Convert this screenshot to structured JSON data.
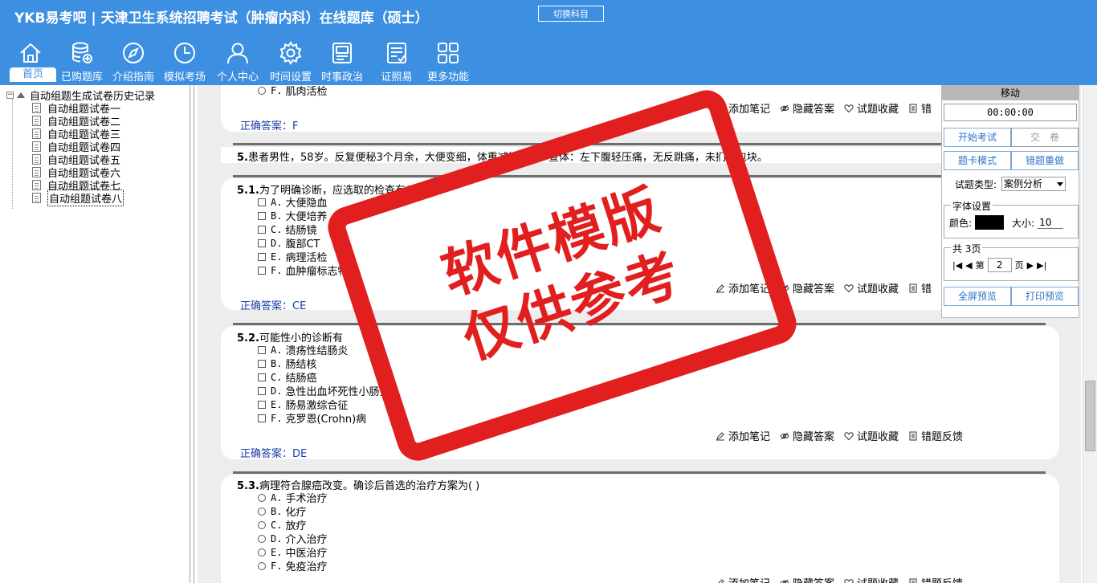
{
  "header": {
    "logo": "YKB易考吧",
    "title": "天津卫生系统招聘考试（肿瘤内科）在线题库（硕士）",
    "switch_subject": "切换科目"
  },
  "nav": [
    {
      "label": "首页",
      "icon": "home-icon"
    },
    {
      "label": "已购题库",
      "icon": "database-icon"
    },
    {
      "label": "介绍指南",
      "icon": "compass-icon"
    },
    {
      "label": "模拟考场",
      "icon": "clock-icon"
    },
    {
      "label": "个人中心",
      "icon": "user-icon"
    },
    {
      "label": "时间设置",
      "icon": "gear-icon"
    },
    {
      "label": "时事政治",
      "icon": "news-icon"
    },
    {
      "label": "证照易",
      "icon": "certificate-icon"
    },
    {
      "label": "更多功能",
      "icon": "grid-icon"
    }
  ],
  "tree": {
    "root": "自动组题生成试卷历史记录",
    "items": [
      "自动组题试卷一",
      "自动组题试卷二",
      "自动组题试卷三",
      "自动组题试卷四",
      "自动组题试卷五",
      "自动组题试卷六",
      "自动组题试卷七",
      "自动组题试卷八"
    ]
  },
  "actions": {
    "note": "添加笔记",
    "hide": "隐藏答案",
    "fav": "试题收藏",
    "feedback": "错题反馈",
    "feedback_short": "错"
  },
  "prev": {
    "last_option_key": "F.",
    "last_option_text": "肌肉活检",
    "answer_label": "正确答案：",
    "answer": "F"
  },
  "case": {
    "num": "5.",
    "text": "患者男性，58岁。反复便秘3个月余，大便变细，体重减轻3kg。查体：左下腹轻压痛，无反跳痛，未扪及包块。"
  },
  "questions": [
    {
      "num": "5.1.",
      "text": "为了明确诊断，应选取的检查有( )",
      "options": [
        {
          "k": "A.",
          "t": "大便隐血"
        },
        {
          "k": "B.",
          "t": "大便培养"
        },
        {
          "k": "C.",
          "t": "结肠镜"
        },
        {
          "k": "D.",
          "t": "腹部CT"
        },
        {
          "k": "E.",
          "t": "病理活检"
        },
        {
          "k": "F.",
          "t": "血肿瘤标志物"
        }
      ],
      "answer_label": "正确答案：",
      "answer": "CE"
    },
    {
      "num": "5.2.",
      "text": "可能性小的诊断有",
      "options": [
        {
          "k": "A.",
          "t": "溃疡性结肠炎"
        },
        {
          "k": "B.",
          "t": "肠结核"
        },
        {
          "k": "C.",
          "t": "结肠癌"
        },
        {
          "k": "D.",
          "t": "急性出血坏死性小肠炎"
        },
        {
          "k": "E.",
          "t": "肠易激综合征"
        },
        {
          "k": "F.",
          "t": "克罗恩(Crohn)病"
        }
      ],
      "answer_label": "正确答案：",
      "answer": "DE"
    },
    {
      "num": "5.3.",
      "text": "病理符合腺癌改变。确诊后首选的治疗方案为( )",
      "options": [
        {
          "k": "A.",
          "t": "手术治疗"
        },
        {
          "k": "B.",
          "t": "化疗"
        },
        {
          "k": "C.",
          "t": "放疗"
        },
        {
          "k": "D.",
          "t": "介入治疗"
        },
        {
          "k": "E.",
          "t": "中医治疗"
        },
        {
          "k": "F.",
          "t": "免疫治疗"
        }
      ]
    }
  ],
  "panel": {
    "move": "移动",
    "timer": "00:00:00",
    "start_exam": "开始考试",
    "submit": "交　卷",
    "card_mode": "题卡模式",
    "redo_wrong": "错题重做",
    "type_label": "试题类型:",
    "type_value": "案例分析",
    "font_group": "字体设置",
    "color_label": "颜色:",
    "size_label": "大小:",
    "size_value": "10",
    "pages_group": "共 3页",
    "page_prefix": "第",
    "page_value": "2",
    "page_suffix": "页",
    "fullscreen": "全屏预览",
    "print": "打印预览"
  },
  "stamp": {
    "line1": "软件模版",
    "line2": "仅供参考"
  },
  "colors": {
    "header": "#3d8fe1",
    "answer": "#1b3ea8",
    "stamp": "#e21f1f"
  }
}
